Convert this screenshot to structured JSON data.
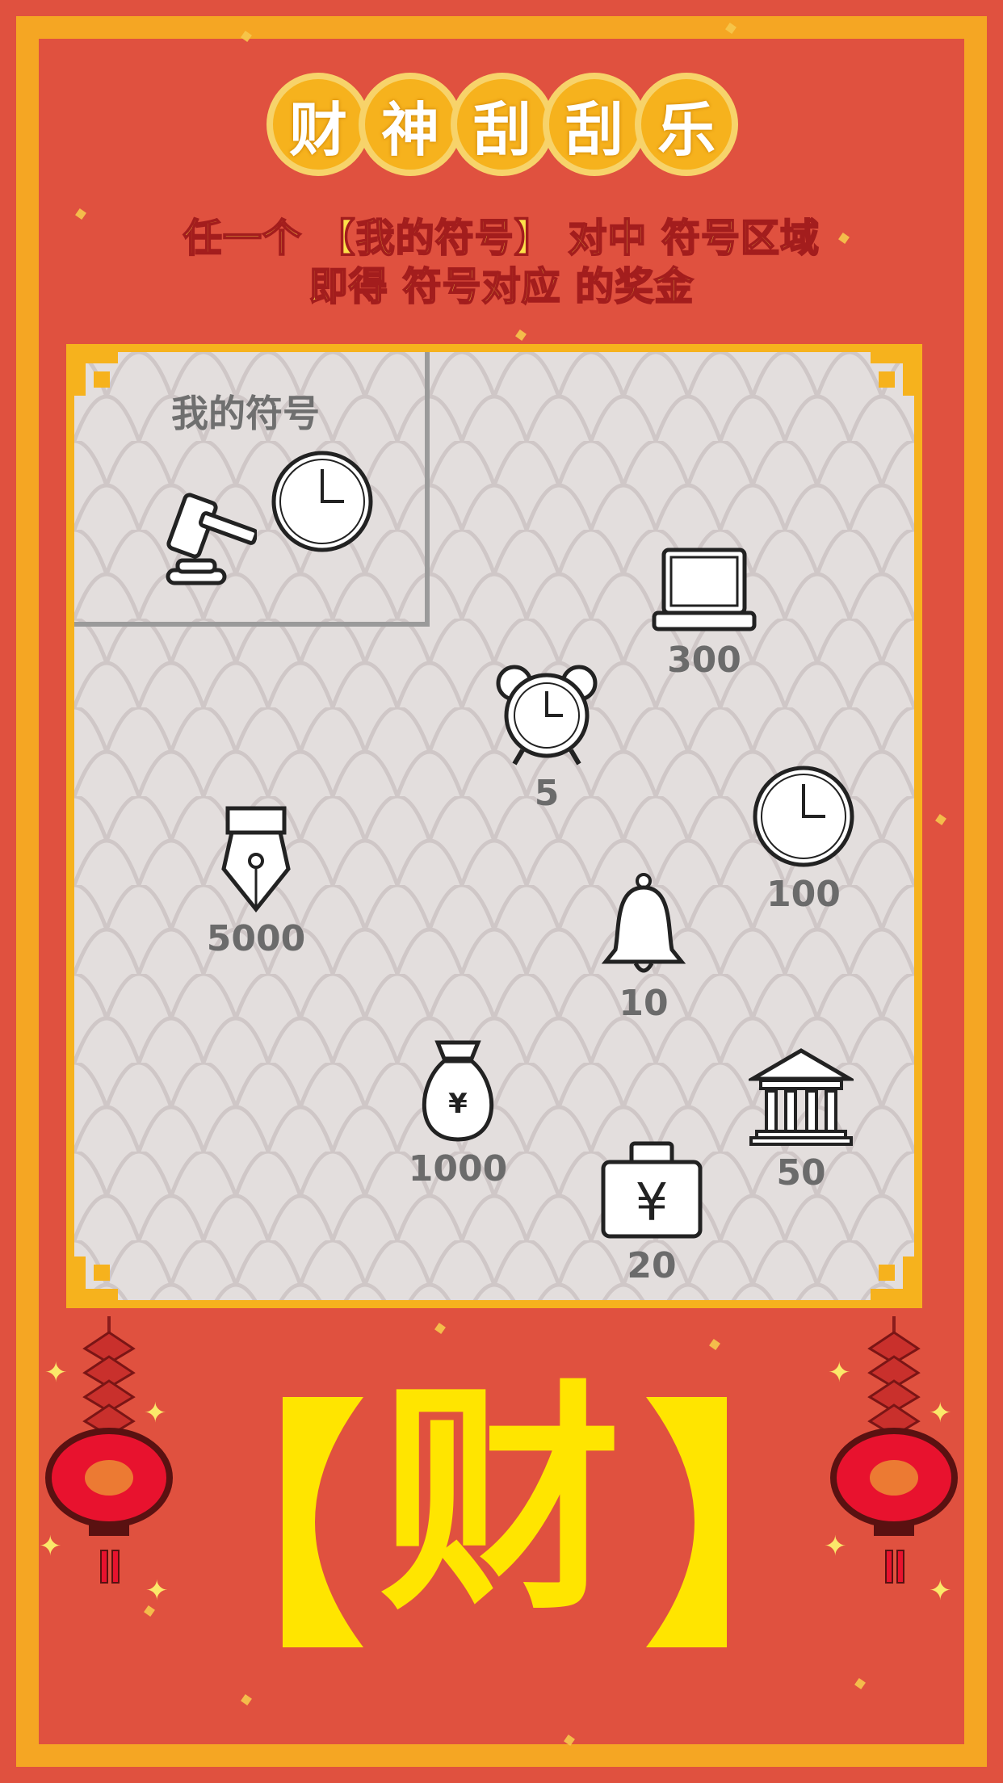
{
  "title": {
    "chars": [
      "财",
      "神",
      "刮",
      "刮",
      "乐"
    ]
  },
  "rules": {
    "line1": "任一个 【我的符号】 对中 符号区域",
    "line2": "即得 符号对应 的奖金"
  },
  "my_symbols": {
    "label": "我的符号",
    "icons": [
      "gavel-icon",
      "clock-icon"
    ]
  },
  "prizes": [
    {
      "icon": "laptop-icon",
      "value": "300"
    },
    {
      "icon": "alarm-clock-icon",
      "value": "5"
    },
    {
      "icon": "clock-icon",
      "value": "100"
    },
    {
      "icon": "fountain-pen-icon",
      "value": "5000"
    },
    {
      "icon": "bell-icon",
      "value": "10"
    },
    {
      "icon": "money-bag-icon",
      "value": "1000"
    },
    {
      "icon": "bank-icon",
      "value": "50"
    },
    {
      "icon": "yuan-briefcase-icon",
      "value": "20"
    }
  ],
  "bottom": {
    "char": "财"
  },
  "colors": {
    "background": "#e0513f",
    "border": "#f5a623",
    "card": "#e3dedd",
    "gold": "#ffe500",
    "text_gray": "#6b6b6b"
  }
}
